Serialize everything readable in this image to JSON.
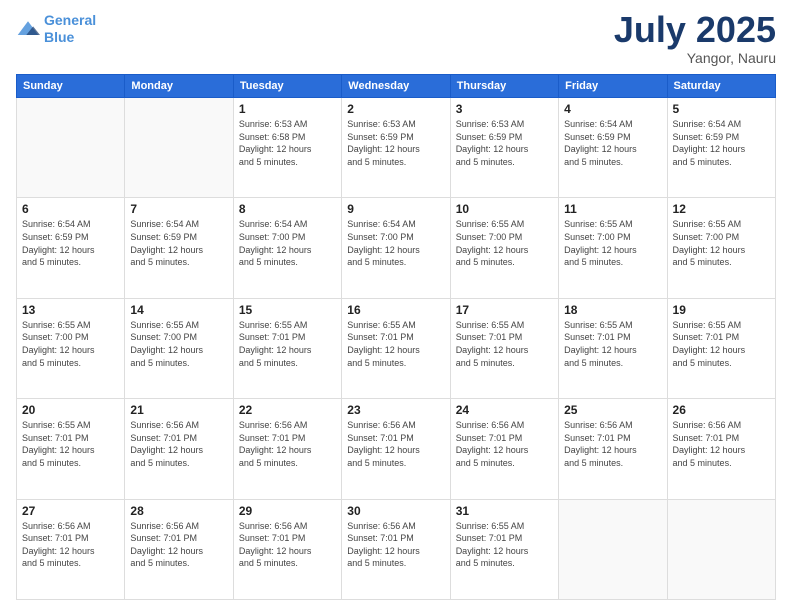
{
  "logo": {
    "line1": "General",
    "line2": "Blue"
  },
  "title": {
    "month_year": "July 2025",
    "location": "Yangor, Nauru"
  },
  "days_of_week": [
    "Sunday",
    "Monday",
    "Tuesday",
    "Wednesday",
    "Thursday",
    "Friday",
    "Saturday"
  ],
  "weeks": [
    [
      {
        "day": "",
        "info": ""
      },
      {
        "day": "",
        "info": ""
      },
      {
        "day": "1",
        "info": "Sunrise: 6:53 AM\nSunset: 6:58 PM\nDaylight: 12 hours\nand 5 minutes."
      },
      {
        "day": "2",
        "info": "Sunrise: 6:53 AM\nSunset: 6:59 PM\nDaylight: 12 hours\nand 5 minutes."
      },
      {
        "day": "3",
        "info": "Sunrise: 6:53 AM\nSunset: 6:59 PM\nDaylight: 12 hours\nand 5 minutes."
      },
      {
        "day": "4",
        "info": "Sunrise: 6:54 AM\nSunset: 6:59 PM\nDaylight: 12 hours\nand 5 minutes."
      },
      {
        "day": "5",
        "info": "Sunrise: 6:54 AM\nSunset: 6:59 PM\nDaylight: 12 hours\nand 5 minutes."
      }
    ],
    [
      {
        "day": "6",
        "info": "Sunrise: 6:54 AM\nSunset: 6:59 PM\nDaylight: 12 hours\nand 5 minutes."
      },
      {
        "day": "7",
        "info": "Sunrise: 6:54 AM\nSunset: 6:59 PM\nDaylight: 12 hours\nand 5 minutes."
      },
      {
        "day": "8",
        "info": "Sunrise: 6:54 AM\nSunset: 7:00 PM\nDaylight: 12 hours\nand 5 minutes."
      },
      {
        "day": "9",
        "info": "Sunrise: 6:54 AM\nSunset: 7:00 PM\nDaylight: 12 hours\nand 5 minutes."
      },
      {
        "day": "10",
        "info": "Sunrise: 6:55 AM\nSunset: 7:00 PM\nDaylight: 12 hours\nand 5 minutes."
      },
      {
        "day": "11",
        "info": "Sunrise: 6:55 AM\nSunset: 7:00 PM\nDaylight: 12 hours\nand 5 minutes."
      },
      {
        "day": "12",
        "info": "Sunrise: 6:55 AM\nSunset: 7:00 PM\nDaylight: 12 hours\nand 5 minutes."
      }
    ],
    [
      {
        "day": "13",
        "info": "Sunrise: 6:55 AM\nSunset: 7:00 PM\nDaylight: 12 hours\nand 5 minutes."
      },
      {
        "day": "14",
        "info": "Sunrise: 6:55 AM\nSunset: 7:00 PM\nDaylight: 12 hours\nand 5 minutes."
      },
      {
        "day": "15",
        "info": "Sunrise: 6:55 AM\nSunset: 7:01 PM\nDaylight: 12 hours\nand 5 minutes."
      },
      {
        "day": "16",
        "info": "Sunrise: 6:55 AM\nSunset: 7:01 PM\nDaylight: 12 hours\nand 5 minutes."
      },
      {
        "day": "17",
        "info": "Sunrise: 6:55 AM\nSunset: 7:01 PM\nDaylight: 12 hours\nand 5 minutes."
      },
      {
        "day": "18",
        "info": "Sunrise: 6:55 AM\nSunset: 7:01 PM\nDaylight: 12 hours\nand 5 minutes."
      },
      {
        "day": "19",
        "info": "Sunrise: 6:55 AM\nSunset: 7:01 PM\nDaylight: 12 hours\nand 5 minutes."
      }
    ],
    [
      {
        "day": "20",
        "info": "Sunrise: 6:55 AM\nSunset: 7:01 PM\nDaylight: 12 hours\nand 5 minutes."
      },
      {
        "day": "21",
        "info": "Sunrise: 6:56 AM\nSunset: 7:01 PM\nDaylight: 12 hours\nand 5 minutes."
      },
      {
        "day": "22",
        "info": "Sunrise: 6:56 AM\nSunset: 7:01 PM\nDaylight: 12 hours\nand 5 minutes."
      },
      {
        "day": "23",
        "info": "Sunrise: 6:56 AM\nSunset: 7:01 PM\nDaylight: 12 hours\nand 5 minutes."
      },
      {
        "day": "24",
        "info": "Sunrise: 6:56 AM\nSunset: 7:01 PM\nDaylight: 12 hours\nand 5 minutes."
      },
      {
        "day": "25",
        "info": "Sunrise: 6:56 AM\nSunset: 7:01 PM\nDaylight: 12 hours\nand 5 minutes."
      },
      {
        "day": "26",
        "info": "Sunrise: 6:56 AM\nSunset: 7:01 PM\nDaylight: 12 hours\nand 5 minutes."
      }
    ],
    [
      {
        "day": "27",
        "info": "Sunrise: 6:56 AM\nSunset: 7:01 PM\nDaylight: 12 hours\nand 5 minutes."
      },
      {
        "day": "28",
        "info": "Sunrise: 6:56 AM\nSunset: 7:01 PM\nDaylight: 12 hours\nand 5 minutes."
      },
      {
        "day": "29",
        "info": "Sunrise: 6:56 AM\nSunset: 7:01 PM\nDaylight: 12 hours\nand 5 minutes."
      },
      {
        "day": "30",
        "info": "Sunrise: 6:56 AM\nSunset: 7:01 PM\nDaylight: 12 hours\nand 5 minutes."
      },
      {
        "day": "31",
        "info": "Sunrise: 6:55 AM\nSunset: 7:01 PM\nDaylight: 12 hours\nand 5 minutes."
      },
      {
        "day": "",
        "info": ""
      },
      {
        "day": "",
        "info": ""
      }
    ]
  ]
}
